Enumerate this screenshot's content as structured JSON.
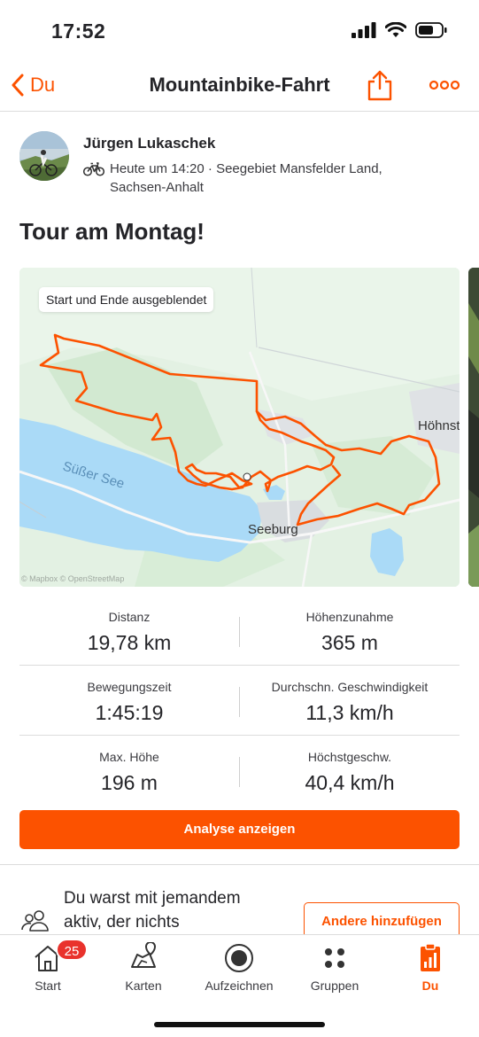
{
  "status_bar": {
    "time": "17:52"
  },
  "nav": {
    "back_label": "Du",
    "title": "Mountainbike-Fahrt"
  },
  "athlete": {
    "name": "Jürgen Lukaschek",
    "meta_line1": "Heute um 14:20 · Seegebiet Mansfelder Land,",
    "meta_line2": "Sachsen-Anhalt"
  },
  "activity": {
    "title": "Tour am Montag!"
  },
  "map": {
    "privacy_chip": "Start und Ende ausgeblendet",
    "labels": {
      "lake": "Süßer See",
      "town_1": "Seeburg",
      "town_2": "Höhnst"
    },
    "attribution": "© Mapbox © OpenStreetMap",
    "route_color": "#fc5200",
    "water_color": "#aadaf7",
    "land_color": "#e3f1e3"
  },
  "stats": [
    {
      "left": {
        "label": "Distanz",
        "value": "19,78 km"
      },
      "right": {
        "label": "Höhenzunahme",
        "value": "365 m"
      }
    },
    {
      "left": {
        "label": "Bewegungszeit",
        "value": "1:45:19"
      },
      "right": {
        "label": "Durchschn. Geschwindigkeit",
        "value": "11,3 km/h"
      }
    },
    {
      "left": {
        "label": "Max. Höhe",
        "value": "196 m"
      },
      "right": {
        "label": "Höchstgeschw.",
        "value": "40,4 km/h"
      }
    }
  ],
  "analyse_button": "Analyse anzeigen",
  "group_activity": {
    "text_line1": "Du warst mit jemandem",
    "text_line2": "aktiv, der nichts",
    "button": "Andere hinzufügen"
  },
  "tabs": [
    {
      "label": "Start",
      "icon": "home-icon",
      "badge": "25"
    },
    {
      "label": "Karten",
      "icon": "map-icon"
    },
    {
      "label": "Aufzeichnen",
      "icon": "record-icon"
    },
    {
      "label": "Gruppen",
      "icon": "groups-icon"
    },
    {
      "label": "Du",
      "icon": "profile-icon",
      "active": true
    }
  ],
  "colors": {
    "accent": "#fc5200",
    "badge": "#e9322c",
    "text": "#242428"
  }
}
